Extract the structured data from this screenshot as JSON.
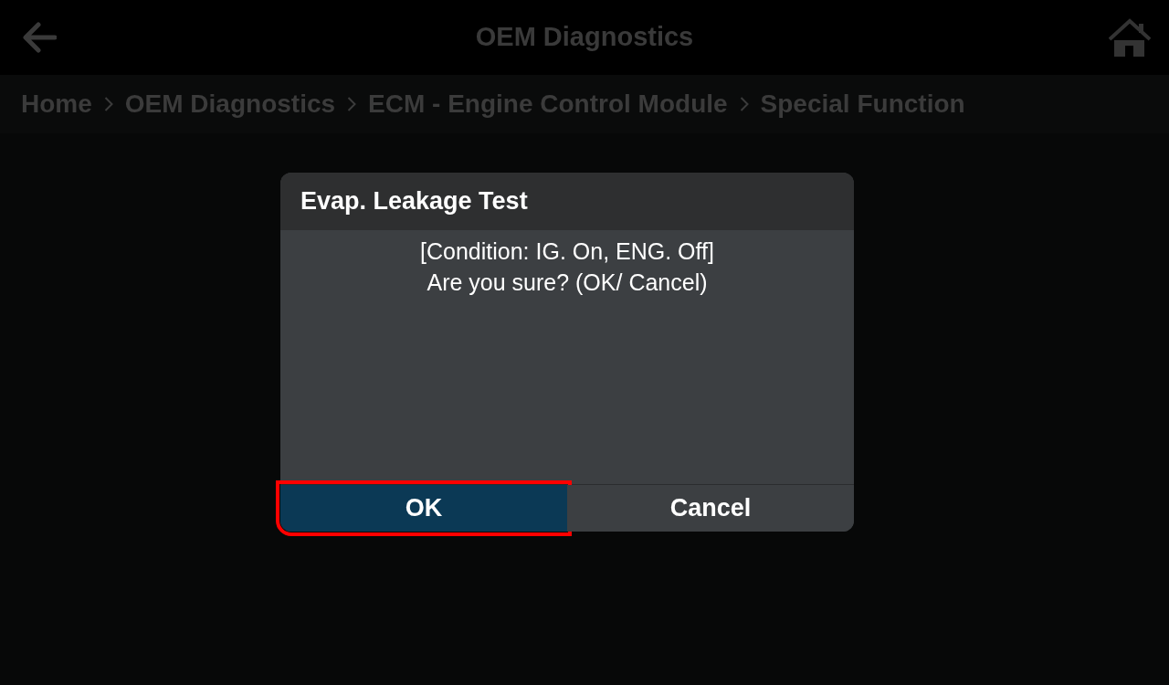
{
  "header": {
    "title": "OEM Diagnostics"
  },
  "breadcrumb": [
    "Home",
    "OEM Diagnostics",
    "ECM - Engine Control Module",
    "Special Function"
  ],
  "dialog": {
    "title": "Evap. Leakage Test",
    "message": [
      "[Condition: IG. On, ENG. Off]",
      "Are you sure? (OK/ Cancel)"
    ],
    "buttons": [
      {
        "label": "OK",
        "selected": true,
        "highlighted": true
      },
      {
        "label": "Cancel",
        "selected": false,
        "highlighted": false
      }
    ]
  }
}
